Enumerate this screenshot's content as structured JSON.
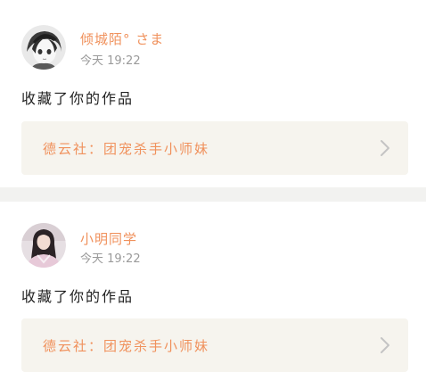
{
  "feed": {
    "items": [
      {
        "username": "倾城陌° さま",
        "time": "今天 19:22",
        "action": "收藏了你的作品",
        "work_title": "德云社：团宠杀手小师妹",
        "avatar_icon": "anime-avatar-icon"
      },
      {
        "username": "小明同学",
        "time": "今天 19:22",
        "action": "收藏了你的作品",
        "work_title": "德云社：团宠杀手小师妹",
        "avatar_icon": "photo-avatar-icon"
      }
    ]
  },
  "colors": {
    "accent": "#f0915c",
    "muted": "#9a9a9a",
    "card_bg": "#f6f4ee",
    "divider": "#f2f2f0"
  }
}
